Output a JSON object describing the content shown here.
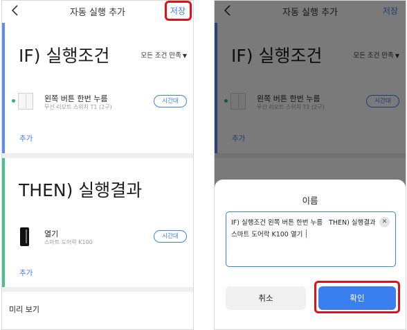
{
  "header": {
    "title": "자동 실행 추가",
    "save_label": "저장"
  },
  "if_section": {
    "heading": "IF) 실행조건",
    "match_mode": "모든 조건 만족",
    "items": [
      {
        "title": "왼쪽 버튼 한번 누름",
        "subtitle": "무선 리모트 스위치 T1 (2구)",
        "chip": "시간대"
      }
    ],
    "add_label": "추가"
  },
  "then_section": {
    "heading": "THEN) 실행결과",
    "items": [
      {
        "title": "열기",
        "subtitle": "스마트 도어락 K100",
        "chip": "시간대"
      }
    ],
    "add_label": "추가"
  },
  "preview_label": "미리 보기",
  "dialog": {
    "title": "이름",
    "name_value": "IF) 실행조건 왼쪽 버튼 한번 누름   THEN) 실행결과 스마트 도어락 K100 열기",
    "cancel_label": "취소",
    "confirm_label": "확인"
  },
  "colors": {
    "accent": "#3a7ff0",
    "if_bar": "#5b8ef0",
    "then_bar": "#4cc08a",
    "highlight": "#e0101b",
    "status_dot": "#2fb673"
  },
  "icons": [
    "back-arrow-icon",
    "dropdown-triangle-icon",
    "remote-switch-device-icon",
    "door-lock-device-icon",
    "clear-icon"
  ]
}
